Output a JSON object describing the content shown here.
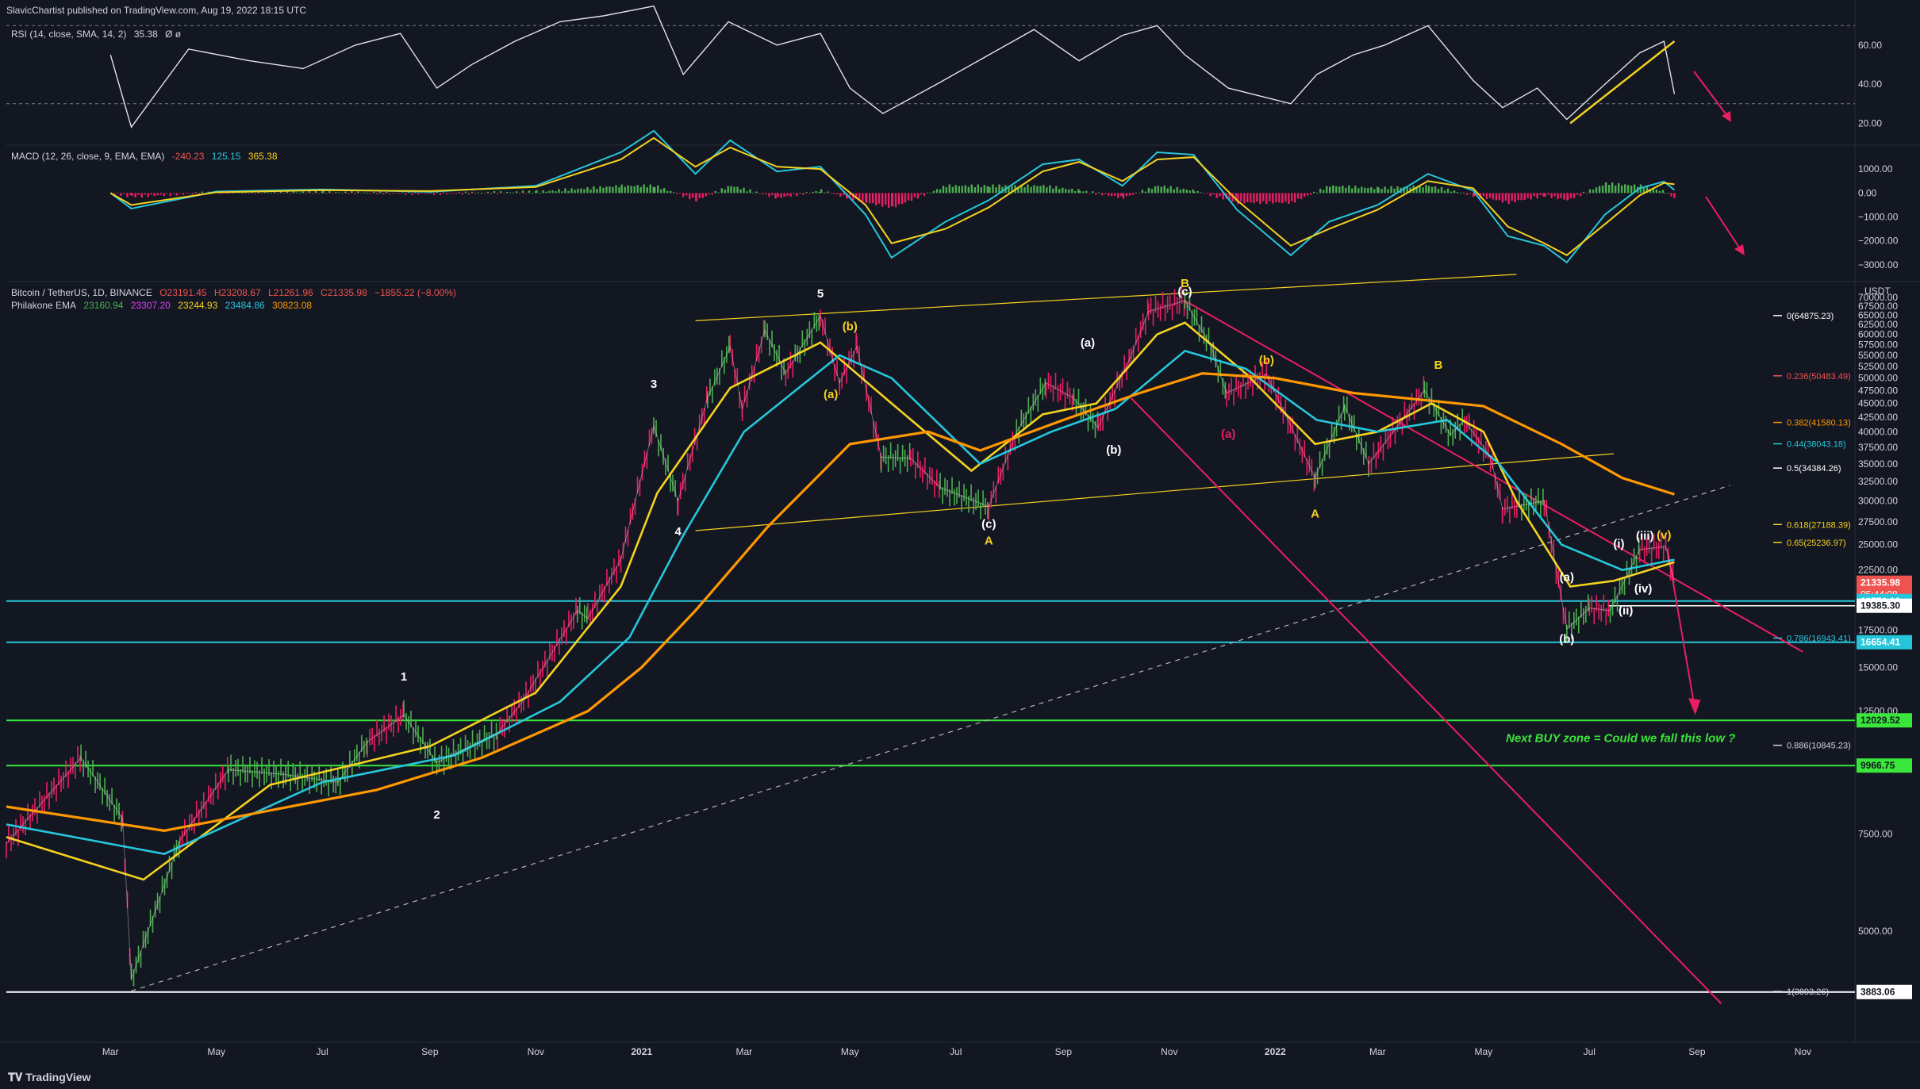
{
  "header": {
    "publisher": "SlavicChartist published on TradingView.com, Aug 19, 2022 18:15 UTC",
    "rsi_label": "RSI (14, close, SMA, 14, 2)",
    "rsi_value": "35.38",
    "rsi_extra": "Ø ø",
    "macd_label": "MACD (12, 26, close, 9, EMA, EMA)",
    "macd_hist": "-240.23",
    "macd_line": "125.15",
    "macd_signal": "365.38",
    "symbol": "Bitcoin / TetherUS, 1D, BINANCE",
    "o": "O23191.45",
    "h": "H23208.67",
    "l": "L21261.96",
    "c": "C21335.98",
    "chg": "−1855.22 (−8.00%)",
    "ema_label": "Philakone EMA",
    "ema_values": [
      "23160.94",
      "23307.20",
      "23244.93",
      "23484.86",
      "30823.08"
    ],
    "currency": "USDT",
    "footer": "TradingView"
  },
  "colors": {
    "background": "#131722",
    "grid": "#2a2e39",
    "text": "#d1d4dc",
    "yellow": "#f5d21f",
    "orange": "#ff9800",
    "cyan": "#26c6da",
    "pink": "#e91e63",
    "green": "#4caf50",
    "red": "#ef5350",
    "lime": "#39e639",
    "white": "#ffffff"
  },
  "chart_data": [
    {
      "type": "line",
      "panel": "rsi",
      "title": "RSI (14, close, SMA, 14, 2)",
      "y_ticks": [
        20.0,
        40.0,
        60.0
      ],
      "y_tick_labels": [
        "20.00",
        "40.00",
        "60.00"
      ],
      "ylim": [
        10,
        75
      ],
      "bands": [
        30,
        70
      ],
      "x": [
        "2020-03-01",
        "2020-03-13",
        "2020-04-15",
        "2020-05-20",
        "2020-06-20",
        "2020-07-20",
        "2020-08-15",
        "2020-09-05",
        "2020-09-25",
        "2020-10-20",
        "2020-11-15",
        "2020-12-10",
        "2021-01-08",
        "2021-01-25",
        "2021-02-20",
        "2021-03-20",
        "2021-04-14",
        "2021-05-01",
        "2021-05-20",
        "2021-06-20",
        "2021-07-20",
        "2021-08-15",
        "2021-09-10",
        "2021-10-05",
        "2021-10-25",
        "2021-11-10",
        "2021-12-05",
        "2022-01-10",
        "2022-01-25",
        "2022-02-15",
        "2022-03-05",
        "2022-03-30",
        "2022-04-25",
        "2022-05-12",
        "2022-06-01",
        "2022-06-18",
        "2022-07-10",
        "2022-07-30",
        "2022-08-13",
        "2022-08-19"
      ],
      "values": [
        55,
        18,
        58,
        52,
        48,
        60,
        66,
        38,
        50,
        62,
        72,
        75,
        80,
        45,
        72,
        60,
        66,
        38,
        25,
        40,
        55,
        68,
        52,
        65,
        70,
        55,
        38,
        30,
        45,
        55,
        60,
        70,
        42,
        28,
        38,
        22,
        40,
        56,
        62,
        35
      ],
      "trendline": {
        "x": [
          "2022-06-20",
          "2022-08-19"
        ],
        "y": [
          20,
          62
        ]
      }
    },
    {
      "type": "bar",
      "panel": "macd",
      "title": "MACD (12, 26, close, 9, EMA, EMA)",
      "y_ticks": [
        1000,
        0,
        -1000,
        -2000,
        -3000
      ],
      "y_tick_labels": [
        "1000.00",
        "0.00",
        "−1000.00",
        "−2000.00",
        "−3000.00"
      ],
      "ylim": [
        -3600,
        1900
      ],
      "x": [
        "2020-03-01",
        "2020-03-13",
        "2020-05-01",
        "2020-07-01",
        "2020-09-01",
        "2020-11-01",
        "2020-12-20",
        "2021-01-08",
        "2021-02-01",
        "2021-02-21",
        "2021-03-20",
        "2021-04-14",
        "2021-05-10",
        "2021-05-25",
        "2021-06-25",
        "2021-07-20",
        "2021-08-20",
        "2021-09-10",
        "2021-10-05",
        "2021-10-25",
        "2021-11-15",
        "2021-12-10",
        "2022-01-10",
        "2022-02-01",
        "2022-03-01",
        "2022-03-30",
        "2022-04-25",
        "2022-05-15",
        "2022-06-05",
        "2022-06-18",
        "2022-07-10",
        "2022-07-30",
        "2022-08-13",
        "2022-08-19"
      ],
      "series": [
        {
          "name": "MACD",
          "values": [
            0,
            -650,
            60,
            150,
            50,
            300,
            1700,
            2600,
            800,
            2200,
            900,
            1100,
            -900,
            -2700,
            -1200,
            -300,
            1200,
            1400,
            300,
            1700,
            1600,
            -700,
            -2600,
            -1200,
            -500,
            800,
            100,
            -1800,
            -2200,
            -2900,
            -900,
            200,
            480,
            125
          ]
        },
        {
          "name": "Signal",
          "values": [
            0,
            -500,
            30,
            120,
            80,
            250,
            1400,
            2300,
            1100,
            1900,
            1100,
            1000,
            -500,
            -2100,
            -1500,
            -600,
            900,
            1300,
            500,
            1400,
            1500,
            -300,
            -2200,
            -1500,
            -700,
            500,
            200,
            -1400,
            -2100,
            -2600,
            -1300,
            -100,
            420,
            365
          ]
        },
        {
          "name": "Histogram",
          "values": [
            0,
            -150,
            30,
            30,
            -30,
            50,
            300,
            300,
            -300,
            300,
            -200,
            100,
            -400,
            -600,
            300,
            300,
            300,
            100,
            -200,
            300,
            100,
            -400,
            -400,
            300,
            200,
            300,
            -100,
            -400,
            -100,
            -300,
            400,
            300,
            60,
            -240
          ]
        }
      ]
    },
    {
      "type": "line",
      "panel": "price",
      "title": "Bitcoin / TetherUS, 1D, BINANCE",
      "scale": "log",
      "ylim": [
        3300,
        74000
      ],
      "y_ticks": [
        5000,
        7500,
        10000,
        12500,
        15000,
        17500,
        20000,
        22500,
        25000,
        27500,
        30000,
        32500,
        35000,
        37500,
        40000,
        42500,
        45000,
        47500,
        50000,
        52500,
        55000,
        57500,
        60000,
        62500,
        65000,
        67500,
        70000
      ],
      "y_tick_labels": [
        "5000.00",
        "7500.00",
        "10000.00",
        "12500.00",
        "15000.00",
        "17500.00",
        "20000.00",
        "22500.00",
        "25000.00",
        "27500.00",
        "30000.00",
        "32500.00",
        "35000.00",
        "37500.00",
        "40000.00",
        "42500.00",
        "45000.00",
        "47500.00",
        "50000.00",
        "52500.00",
        "55000.00",
        "57500.00",
        "60000.00",
        "62500.00",
        "65000.00",
        "67500.00",
        "70000.00"
      ],
      "x_tick_labels": [
        "Mar",
        "May",
        "Jul",
        "Sep",
        "Nov",
        "2021",
        "Mar",
        "May",
        "Jul",
        "Sep",
        "Nov",
        "2022",
        "Mar",
        "May",
        "Jul",
        "Sep",
        "Nov"
      ],
      "x_ticks": [
        "2020-03-01",
        "2020-05-01",
        "2020-07-01",
        "2020-09-01",
        "2020-11-01",
        "2021-01-01",
        "2021-03-01",
        "2021-05-01",
        "2021-07-01",
        "2021-09-01",
        "2021-11-01",
        "2022-01-01",
        "2022-03-01",
        "2022-05-01",
        "2022-07-01",
        "2022-09-01",
        "2022-11-01"
      ],
      "xlim": [
        "2020-01-01",
        "2022-12-01"
      ],
      "series": [
        {
          "name": "BTCUSDT",
          "x": [
            "2020-01-01",
            "2020-02-13",
            "2020-03-08",
            "2020-03-13",
            "2020-04-10",
            "2020-05-08",
            "2020-06-10",
            "2020-07-10",
            "2020-07-27",
            "2020-08-17",
            "2020-09-05",
            "2020-10-10",
            "2020-10-25",
            "2020-11-25",
            "2020-12-01",
            "2020-12-20",
            "2021-01-08",
            "2021-01-22",
            "2021-02-08",
            "2021-02-21",
            "2021-02-28",
            "2021-03-13",
            "2021-03-25",
            "2021-04-14",
            "2021-04-25",
            "2021-05-05",
            "2021-05-19",
            "2021-06-05",
            "2021-06-22",
            "2021-07-20",
            "2021-08-05",
            "2021-08-22",
            "2021-09-07",
            "2021-09-21",
            "2021-10-10",
            "2021-10-20",
            "2021-11-10",
            "2021-11-25",
            "2021-12-04",
            "2021-12-27",
            "2022-01-24",
            "2022-02-10",
            "2022-02-24",
            "2022-03-28",
            "2022-04-12",
            "2022-04-20",
            "2022-05-05",
            "2022-05-12",
            "2022-06-05",
            "2022-06-18",
            "2022-07-01",
            "2022-07-13",
            "2022-07-30",
            "2022-08-14",
            "2022-08-19"
          ],
          "values": [
            7200,
            10300,
            8000,
            4100,
            7300,
            9800,
            9600,
            9300,
            11000,
            12300,
            10100,
            11400,
            13100,
            19000,
            18400,
            23500,
            41000,
            30000,
            46000,
            57000,
            44000,
            61000,
            51000,
            64800,
            49000,
            57000,
            36000,
            35800,
            31700,
            29300,
            40000,
            49000,
            46000,
            40700,
            55000,
            66000,
            69000,
            57000,
            47000,
            50800,
            33000,
            44500,
            35000,
            47500,
            39500,
            42000,
            36000,
            29000,
            30000,
            17600,
            19200,
            19000,
            24500,
            24800,
            21336
          ]
        },
        {
          "name": "EMA fast (yellow)",
          "x": [
            "2020-01-01",
            "2020-03-20",
            "2020-06-01",
            "2020-09-01",
            "2020-11-01",
            "2020-12-20",
            "2021-01-10",
            "2021-02-21",
            "2021-04-14",
            "2021-05-25",
            "2021-07-10",
            "2021-08-20",
            "2021-09-20",
            "2021-10-25",
            "2021-11-10",
            "2021-12-15",
            "2022-01-24",
            "2022-03-01",
            "2022-04-01",
            "2022-05-01",
            "2022-05-20",
            "2022-06-20",
            "2022-07-15",
            "2022-08-19"
          ],
          "values": [
            7400,
            6200,
            9200,
            10800,
            13500,
            21000,
            31000,
            48000,
            58000,
            45000,
            34000,
            43000,
            45000,
            60000,
            63000,
            51000,
            38000,
            40000,
            45000,
            40000,
            30000,
            21000,
            21500,
            23245
          ]
        },
        {
          "name": "EMA mid (cyan)",
          "x": [
            "2020-01-01",
            "2020-04-01",
            "2020-07-01",
            "2020-09-15",
            "2020-11-15",
            "2020-12-25",
            "2021-01-25",
            "2021-03-01",
            "2021-04-25",
            "2021-05-25",
            "2021-07-15",
            "2021-08-25",
            "2021-10-01",
            "2021-11-10",
            "2021-12-15",
            "2022-01-25",
            "2022-03-01",
            "2022-04-10",
            "2022-05-10",
            "2022-06-15",
            "2022-07-20",
            "2022-08-19"
          ],
          "values": [
            7800,
            6900,
            9300,
            10400,
            13000,
            17000,
            26000,
            40000,
            55000,
            50000,
            35000,
            40000,
            44000,
            56000,
            52000,
            42000,
            40000,
            42000,
            35000,
            25000,
            22500,
            23485
          ]
        },
        {
          "name": "EMA 200 (orange)",
          "x": [
            "2020-01-01",
            "2020-04-01",
            "2020-08-01",
            "2020-10-01",
            "2020-12-01",
            "2021-01-01",
            "2021-02-01",
            "2021-03-15",
            "2021-05-01",
            "2021-06-15",
            "2021-07-15",
            "2021-09-01",
            "2021-10-15",
            "2021-11-20",
            "2022-01-01",
            "2022-02-15",
            "2022-04-01",
            "2022-05-01",
            "2022-06-15",
            "2022-07-20",
            "2022-08-19"
          ],
          "values": [
            8400,
            7600,
            9000,
            10300,
            12500,
            15000,
            19000,
            27000,
            38000,
            40000,
            37000,
            42000,
            47000,
            51000,
            50000,
            47000,
            45500,
            44500,
            38000,
            33000,
            30823
          ]
        }
      ],
      "annotations": [
        "1",
        "2",
        "3",
        "4",
        "5",
        "(i)",
        "(ii)",
        "(iii)",
        "(iv)",
        "(v)",
        "(a)",
        "(b)",
        "(c)",
        "A",
        "B",
        "a",
        "b",
        "c",
        "i",
        "ii",
        "iii",
        "iv",
        "v",
        "(a)",
        "(b)",
        "(c)",
        "(i)",
        "(ii)",
        "(iii)",
        "(iv)",
        "(v)"
      ],
      "fib_levels": [
        {
          "label": "0(64875.23)",
          "value": 64875.23
        },
        {
          "label": "0.236(50483.49)",
          "value": 50483.49
        },
        {
          "label": "0.382(41580.13)",
          "value": 41580.13
        },
        {
          "label": "0.44(38043.18)",
          "value": 38043.18
        },
        {
          "label": "0.5(34384.26)",
          "value": 34384.26
        },
        {
          "label": "0.618(27188.39)",
          "value": 27188.39
        },
        {
          "label": "0.65(25236.97)",
          "value": 25236.97
        },
        {
          "label": "0.786(16943.41)",
          "value": 16943.41
        },
        {
          "label": "0.886(10845.23)",
          "value": 10845.23
        },
        {
          "label": "1(3893.26)",
          "value": 3893.26
        }
      ],
      "price_tags": [
        {
          "label": "21335.98",
          "sub": "05:44:08",
          "value": 21335.98,
          "color": "#ef5350"
        },
        {
          "label": "19770.13",
          "value": 19770.13,
          "color": "#26c6da"
        },
        {
          "label": "19385.30",
          "value": 19385.3,
          "color": "#ffffff"
        },
        {
          "label": "16654.41",
          "value": 16654.41,
          "color": "#26c6da"
        },
        {
          "label": "12029.52",
          "value": 12029.52,
          "color": "#39e639"
        },
        {
          "label": "9966.75",
          "value": 9966.75,
          "color": "#39e639"
        },
        {
          "label": "3883.06",
          "value": 3883.06,
          "color": "#ffffff"
        }
      ],
      "note": "Next BUY zone = Could we fall this low ?"
    }
  ]
}
